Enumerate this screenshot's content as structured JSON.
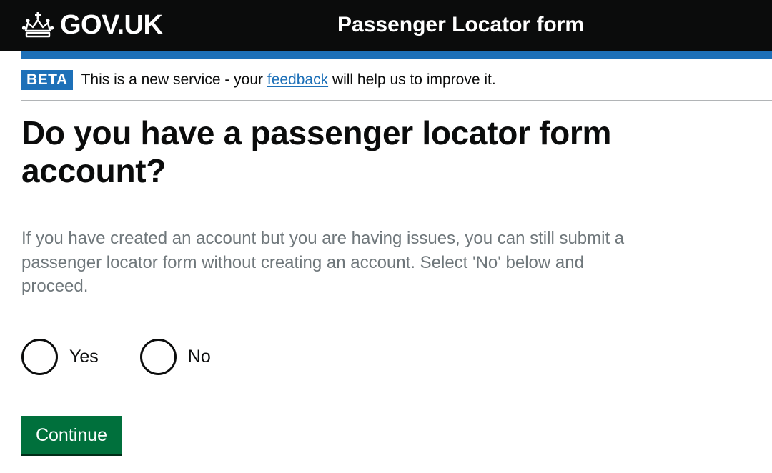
{
  "header": {
    "logo_text": "GOV.UK",
    "logo_icon": "crown-icon",
    "service_name": "Passenger Locator form",
    "background_color": "#0b0c0c",
    "accent_color": "#1d70b8"
  },
  "phase_banner": {
    "tag": "BETA",
    "text_before": "This is a new service - your ",
    "link_text": "feedback",
    "text_after": " will help us to improve it."
  },
  "main": {
    "heading": "Do you have a passenger locator form account?",
    "hint": "If you have created an account but you are having issues, you can still submit a passenger locator form without creating an account. Select 'No' below and proceed.",
    "options": [
      {
        "label": "Yes",
        "selected": false
      },
      {
        "label": "No",
        "selected": false
      }
    ],
    "continue_label": "Continue",
    "button_color": "#00703c"
  }
}
